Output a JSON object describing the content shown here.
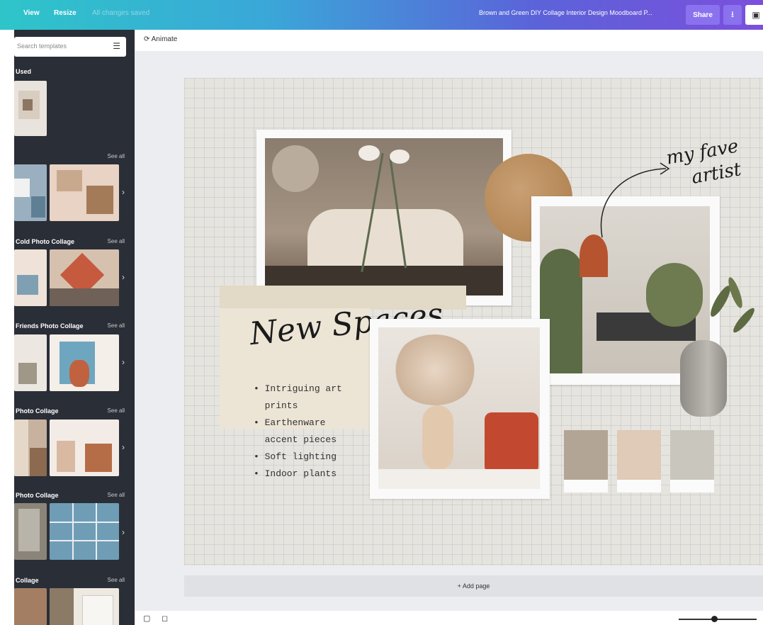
{
  "topbar": {
    "view_label": "View",
    "resize_label": "Resize",
    "all_changes_saved": "All changes saved",
    "doc_title": "Brown and Green DIY Collage Interior Design Moodboard P...",
    "share_label": "Share",
    "download_icon": "download-icon",
    "present_icon": "present-icon"
  },
  "sidebar": {
    "search_placeholder": "Search templates",
    "sections": [
      {
        "title": "Used",
        "see_all": ""
      },
      {
        "title": "",
        "see_all": "See all"
      },
      {
        "title": "Cold Photo Collage",
        "see_all": "See all"
      },
      {
        "title": "Friends Photo Collage",
        "see_all": "See all"
      },
      {
        "title": "Photo Collage",
        "see_all": "See all"
      },
      {
        "title": "Photo Collage",
        "see_all": "See all"
      },
      {
        "title": "Collage",
        "see_all": "See all"
      }
    ]
  },
  "canvas": {
    "animate_label": "Animate",
    "add_page_label": "+ Add page"
  },
  "moodboard": {
    "headline": "New Spaces",
    "annotation_line1": "my fave",
    "annotation_line2": "artist",
    "bullets": [
      "• Intriguing art",
      "  prints",
      "• Earthenware",
      "  accent pieces",
      "• Soft lighting",
      "• Indoor plants"
    ],
    "swatch_colors": [
      "#b3a596",
      "#e0cab8",
      "#c9c6bd"
    ]
  }
}
